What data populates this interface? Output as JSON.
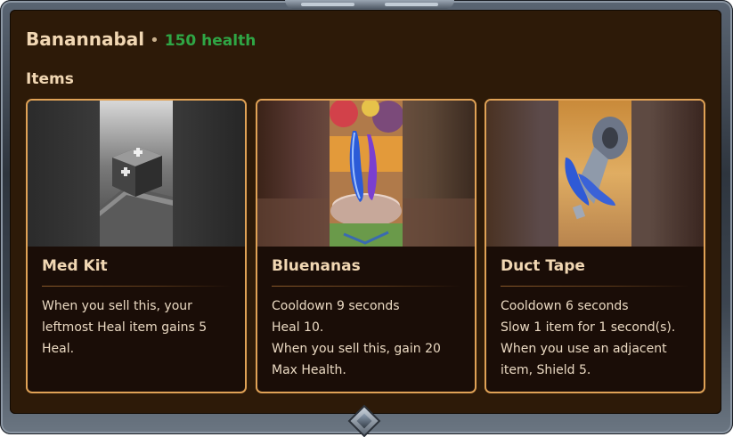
{
  "unit": {
    "name": "Banannabal",
    "separator": "•",
    "health": "150 health"
  },
  "section": {
    "title": "Items"
  },
  "colors": {
    "panel_bg": "#2d1a08",
    "card_border": "#e0a256",
    "health_green": "#2fa645",
    "title_text": "#f1d7b3"
  },
  "items": [
    {
      "name": "Med Kit",
      "icon": "med-kit-icon",
      "lines": [
        "When you sell this, your",
        "leftmost Heal item gains 5",
        "Heal."
      ]
    },
    {
      "name": "Bluenanas",
      "icon": "bluenanas-icon",
      "lines": [
        "Cooldown 9 seconds",
        "Heal 10.",
        "When you sell this, gain 20",
        "Max Health."
      ]
    },
    {
      "name": "Duct Tape",
      "icon": "duct-tape-icon",
      "lines": [
        "Cooldown 6 seconds",
        "Slow 1 item for 1 second(s).",
        "When you use an adjacent",
        "item, Shield 5."
      ]
    }
  ]
}
